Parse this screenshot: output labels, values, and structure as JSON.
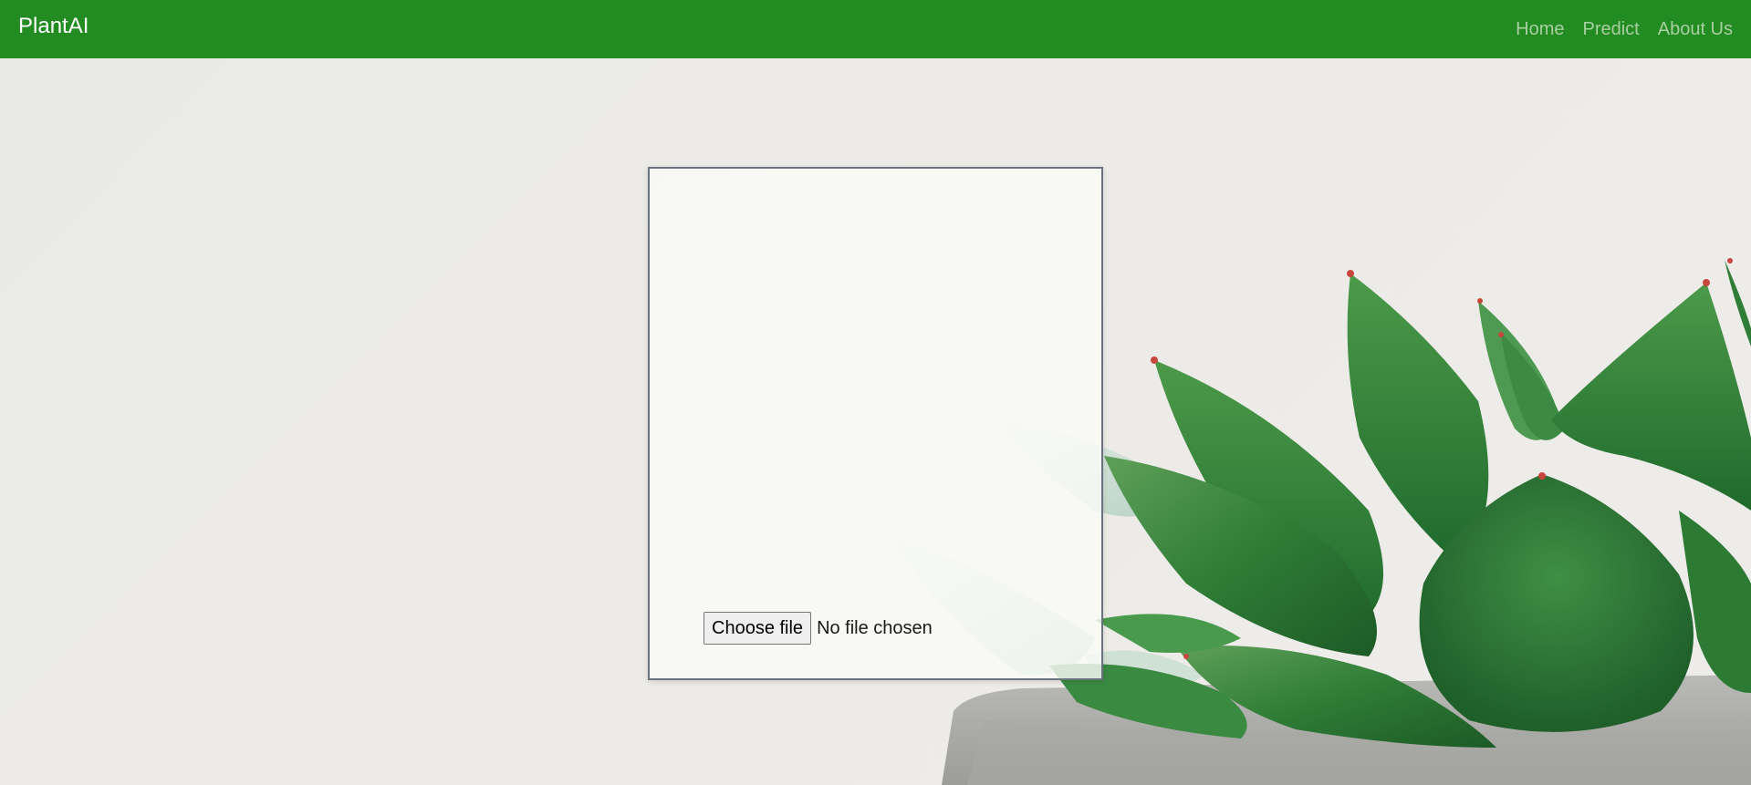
{
  "navbar": {
    "brand": "PlantAI",
    "links": [
      {
        "label": "Home"
      },
      {
        "label": "Predict"
      },
      {
        "label": "About Us"
      }
    ],
    "background_color": "#228b22"
  },
  "upload": {
    "button_label": "Choose file",
    "status_text": "No file chosen"
  },
  "background": {
    "image_subject": "succulent plant in concrete pot",
    "icon": "succulent-plant-image"
  }
}
